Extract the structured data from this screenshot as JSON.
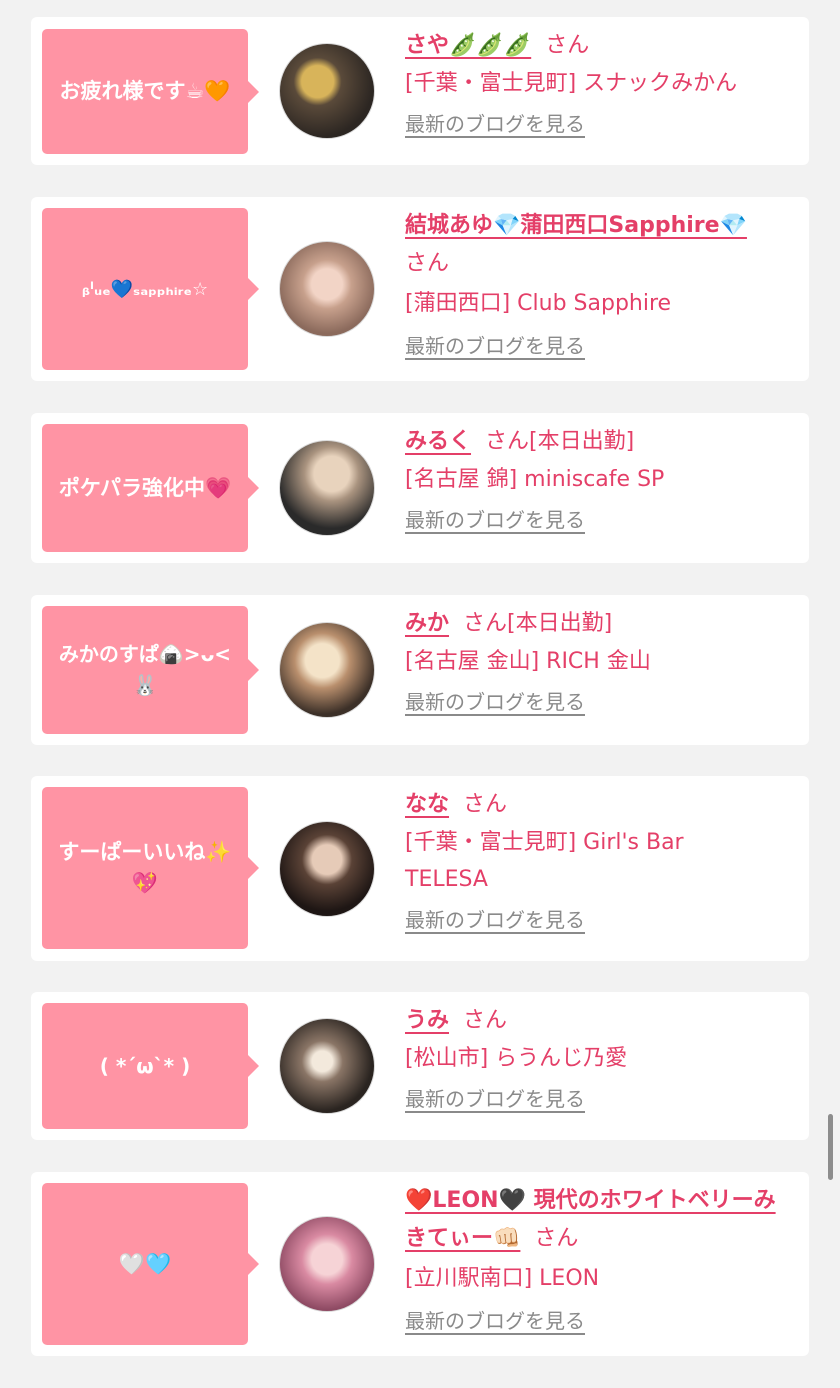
{
  "colors": {
    "page_background": "#f2f2f2",
    "card_background": "#ffffff",
    "bubble_pink": "#ff94a4",
    "name_pink": "#e43f68",
    "link_gray": "#8a8a8a"
  },
  "common": {
    "honorific": "さん",
    "blog_link_label": "最新のブログを見る"
  },
  "posts": [
    {
      "message": "お疲れ様です☕🧡",
      "name": "さや🫛🫛🫛",
      "status": "",
      "shop": "[千葉・富士見町] スナックみかん",
      "avatar_icon": "avatar-photo-icon"
    },
    {
      "message": "ᵦˡᵤₑ💙ₛₐₚₚₕᵢᵣₑ☆",
      "name": "結城あゆ💎蒲田西口Sapphire💎",
      "status": "",
      "shop": "[蒲田西口] Club Sapphire",
      "avatar_icon": "avatar-photo-icon"
    },
    {
      "message": "ポケパラ強化中💗",
      "name": "みるく",
      "status": "[本日出勤]",
      "shop": "[名古屋 錦] miniscafe SP",
      "avatar_icon": "avatar-photo-icon"
    },
    {
      "message": "みかのすぱ🍙>ᴗ<🐰",
      "name": "みか",
      "status": "[本日出勤]",
      "shop": "[名古屋 金山] RICH 金山",
      "avatar_icon": "avatar-photo-icon"
    },
    {
      "message": "すーぱーいいね✨💖",
      "name": "なな",
      "status": "",
      "shop": "[千葉・富士見町] Girl's Bar TELESA",
      "avatar_icon": "avatar-photo-icon"
    },
    {
      "message": "( *´ω`* )",
      "name": "うみ",
      "status": "",
      "shop": "[松山市] らうんじ乃愛",
      "avatar_icon": "avatar-photo-icon"
    },
    {
      "message": "🤍🩵",
      "name": "❤️LEON🖤 現代のホワイトベリーみきてぃー👊🏻",
      "status": "",
      "shop": "[立川駅南口] LEON",
      "avatar_icon": "avatar-photo-icon"
    }
  ]
}
